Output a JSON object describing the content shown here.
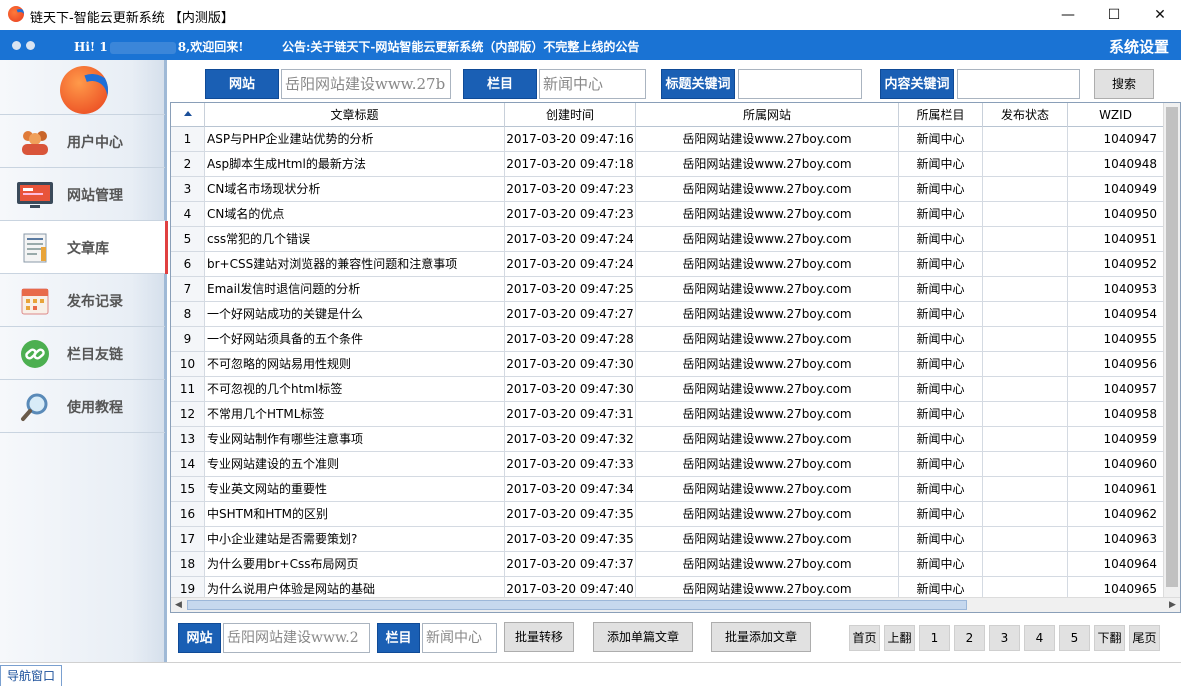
{
  "window": {
    "title": "链天下-智能云更新系统 【内测版】",
    "minimize": "—",
    "maximize": "☐",
    "close": "✕"
  },
  "header": {
    "greeting_prefix": "Hi! 1",
    "greeting_suffix": "8,欢迎回来!",
    "notice": "公告:关于链天下-网站智能云更新系统（内部版）不完整上线的公告",
    "settings": "系统设置"
  },
  "sidebar": {
    "items": [
      {
        "label": "用户中心",
        "icon": "users-icon"
      },
      {
        "label": "网站管理",
        "icon": "monitor-icon"
      },
      {
        "label": "文章库",
        "icon": "document-icon"
      },
      {
        "label": "发布记录",
        "icon": "calendar-icon"
      },
      {
        "label": "栏目友链",
        "icon": "link-icon"
      },
      {
        "label": "使用教程",
        "icon": "magnifier-icon"
      }
    ],
    "active_index": 2
  },
  "search": {
    "site_label": "网站",
    "site_value": "岳阳网站建设www.27b",
    "column_label": "栏目",
    "column_value": "新闻中心",
    "title_kw_label": "标题关键词",
    "title_kw_value": "",
    "content_kw_label": "内容关键词",
    "content_kw_value": "",
    "search_button": "搜索"
  },
  "table": {
    "columns": [
      "文章标题",
      "创建时间",
      "所属网站",
      "所属栏目",
      "发布状态",
      "WZID"
    ],
    "rows": [
      {
        "n": "1",
        "title": "ASP与PHP企业建站优势的分析",
        "time": "2017-03-20 09:47:16",
        "site": "岳阳网站建设www.27boy.com",
        "column": "新闻中心",
        "status": "",
        "wzid": "1040947"
      },
      {
        "n": "2",
        "title": "Asp脚本生成Html的最新方法",
        "time": "2017-03-20 09:47:18",
        "site": "岳阳网站建设www.27boy.com",
        "column": "新闻中心",
        "status": "",
        "wzid": "1040948"
      },
      {
        "n": "3",
        "title": "CN域名市场现状分析",
        "time": "2017-03-20 09:47:23",
        "site": "岳阳网站建设www.27boy.com",
        "column": "新闻中心",
        "status": "",
        "wzid": "1040949"
      },
      {
        "n": "4",
        "title": "CN域名的优点",
        "time": "2017-03-20 09:47:23",
        "site": "岳阳网站建设www.27boy.com",
        "column": "新闻中心",
        "status": "",
        "wzid": "1040950"
      },
      {
        "n": "5",
        "title": "css常犯的几个错误",
        "time": "2017-03-20 09:47:24",
        "site": "岳阳网站建设www.27boy.com",
        "column": "新闻中心",
        "status": "",
        "wzid": "1040951"
      },
      {
        "n": "6",
        "title": "br+CSS建站对浏览器的兼容性问题和注意事项",
        "time": "2017-03-20 09:47:24",
        "site": "岳阳网站建设www.27boy.com",
        "column": "新闻中心",
        "status": "",
        "wzid": "1040952"
      },
      {
        "n": "7",
        "title": "Email发信时退信问题的分析",
        "time": "2017-03-20 09:47:25",
        "site": "岳阳网站建设www.27boy.com",
        "column": "新闻中心",
        "status": "",
        "wzid": "1040953"
      },
      {
        "n": "8",
        "title": "一个好网站成功的关键是什么",
        "time": "2017-03-20 09:47:27",
        "site": "岳阳网站建设www.27boy.com",
        "column": "新闻中心",
        "status": "",
        "wzid": "1040954"
      },
      {
        "n": "9",
        "title": "一个好网站须具备的五个条件",
        "time": "2017-03-20 09:47:28",
        "site": "岳阳网站建设www.27boy.com",
        "column": "新闻中心",
        "status": "",
        "wzid": "1040955"
      },
      {
        "n": "10",
        "title": "不可忽略的网站易用性规则",
        "time": "2017-03-20 09:47:30",
        "site": "岳阳网站建设www.27boy.com",
        "column": "新闻中心",
        "status": "",
        "wzid": "1040956"
      },
      {
        "n": "11",
        "title": "不可忽视的几个html标签",
        "time": "2017-03-20 09:47:30",
        "site": "岳阳网站建设www.27boy.com",
        "column": "新闻中心",
        "status": "",
        "wzid": "1040957"
      },
      {
        "n": "12",
        "title": "不常用几个HTML标签",
        "time": "2017-03-20 09:47:31",
        "site": "岳阳网站建设www.27boy.com",
        "column": "新闻中心",
        "status": "",
        "wzid": "1040958"
      },
      {
        "n": "13",
        "title": "专业网站制作有哪些注意事项",
        "time": "2017-03-20 09:47:32",
        "site": "岳阳网站建设www.27boy.com",
        "column": "新闻中心",
        "status": "",
        "wzid": "1040959"
      },
      {
        "n": "14",
        "title": "专业网站建设的五个准则",
        "time": "2017-03-20 09:47:33",
        "site": "岳阳网站建设www.27boy.com",
        "column": "新闻中心",
        "status": "",
        "wzid": "1040960"
      },
      {
        "n": "15",
        "title": "专业英文网站的重要性",
        "time": "2017-03-20 09:47:34",
        "site": "岳阳网站建设www.27boy.com",
        "column": "新闻中心",
        "status": "",
        "wzid": "1040961"
      },
      {
        "n": "16",
        "title": "中SHTM和HTM的区别",
        "time": "2017-03-20 09:47:35",
        "site": "岳阳网站建设www.27boy.com",
        "column": "新闻中心",
        "status": "",
        "wzid": "1040962"
      },
      {
        "n": "17",
        "title": "中小企业建站是否需要策划?",
        "time": "2017-03-20 09:47:35",
        "site": "岳阳网站建设www.27boy.com",
        "column": "新闻中心",
        "status": "",
        "wzid": "1040963"
      },
      {
        "n": "18",
        "title": "为什么要用br+Css布局网页",
        "time": "2017-03-20 09:47:37",
        "site": "岳阳网站建设www.27boy.com",
        "column": "新闻中心",
        "status": "",
        "wzid": "1040964"
      },
      {
        "n": "19",
        "title": "为什么说用户体验是网站的基础",
        "time": "2017-03-20 09:47:40",
        "site": "岳阳网站建设www.27boy.com",
        "column": "新闻中心",
        "status": "",
        "wzid": "1040965"
      }
    ]
  },
  "bottom": {
    "site_label": "网站",
    "site_value": "岳阳网站建设www.2",
    "column_label": "栏目",
    "column_value": "新闻中心",
    "batch_move": "批量转移",
    "add_single": "添加单篇文章",
    "batch_add": "批量添加文章",
    "pager": {
      "first": "首页",
      "prev": "上翻",
      "pages": [
        "1",
        "2",
        "3",
        "4",
        "5"
      ],
      "next": "下翻",
      "last": "尾页"
    }
  },
  "status": {
    "nav_window": "导航窗口"
  },
  "colors": {
    "header_blue": "#1a73d4",
    "label_blue": "#1a5fb4",
    "active_marker": "#e04040"
  }
}
